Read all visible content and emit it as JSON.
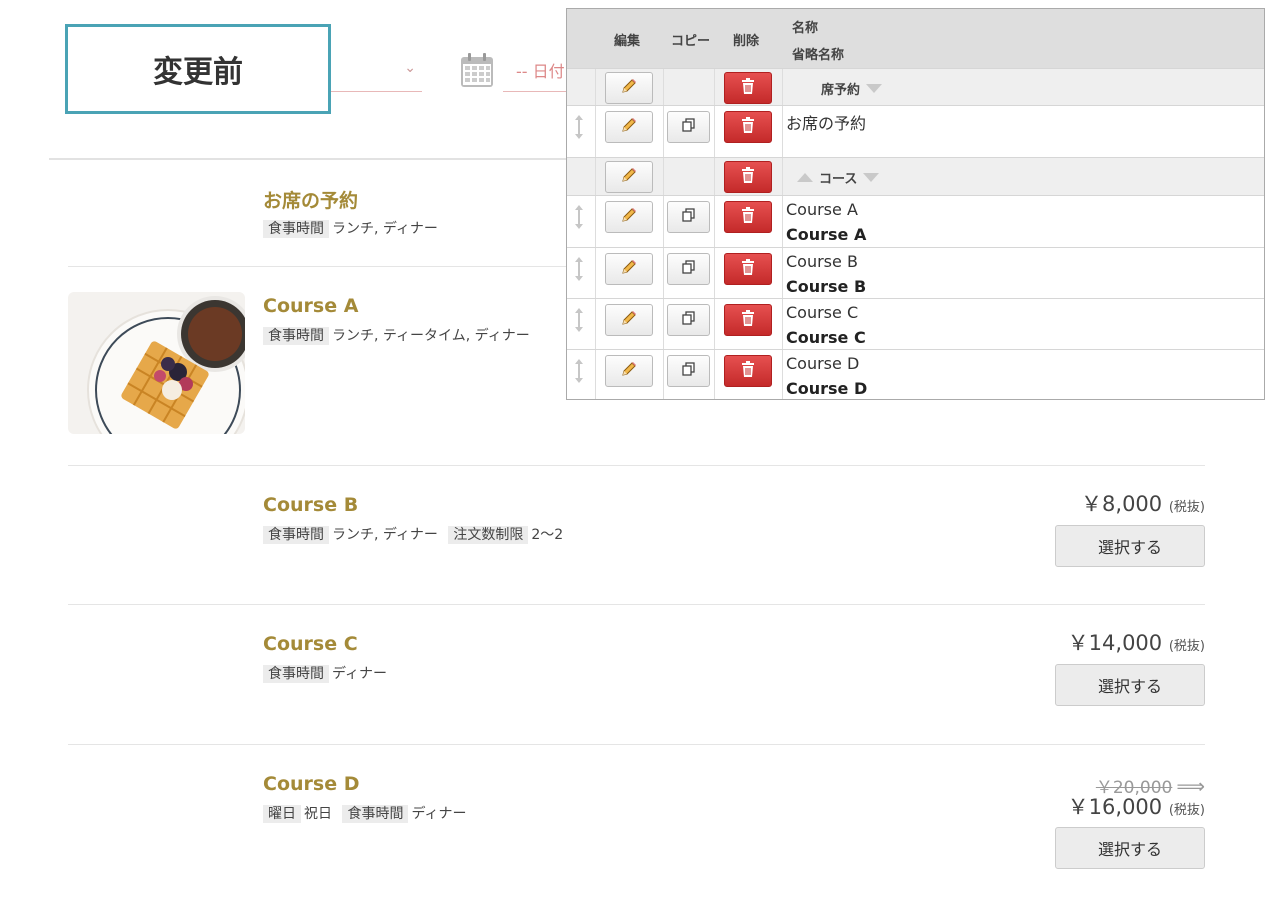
{
  "label_box": "変更前",
  "date_placeholder": "-- 日付",
  "admin": {
    "headers": {
      "edit": "編集",
      "copy": "コピー",
      "delete": "削除",
      "name": "名称",
      "short_name": "省略名称"
    },
    "rows": [
      {
        "type": "group",
        "label": "席予約"
      },
      {
        "type": "item",
        "name": "お席の予約",
        "short": ""
      },
      {
        "type": "group",
        "label": "コース"
      },
      {
        "type": "item",
        "name": "Course A",
        "short": "Course A"
      },
      {
        "type": "item",
        "name": "Course B",
        "short": "Course B"
      },
      {
        "type": "item",
        "name": "Course C",
        "short": "Course C"
      },
      {
        "type": "item",
        "name": "Course D",
        "short": "Course D"
      }
    ]
  },
  "items": [
    {
      "title": "お席の予約",
      "tags": [
        {
          "label": "食事時間",
          "value": "ランチ, ディナー"
        }
      ]
    },
    {
      "title": "Course A",
      "tags": [
        {
          "label": "食事時間",
          "value": "ランチ, ティータイム, ディナー"
        }
      ]
    },
    {
      "title": "Course B",
      "tags": [
        {
          "label": "食事時間",
          "value": "ランチ, ディナー"
        },
        {
          "label": "注文数制限",
          "value": "2～2"
        }
      ],
      "price": "￥8,000",
      "tax": "(税抜)",
      "button": "選択する"
    },
    {
      "title": "Course C",
      "tags": [
        {
          "label": "食事時間",
          "value": "ディナー"
        }
      ],
      "price": "￥14,000",
      "tax": "(税抜)",
      "button": "選択する"
    },
    {
      "title": "Course D",
      "tags": [
        {
          "label": "曜日",
          "value": "祝日"
        },
        {
          "label": "食事時間",
          "value": "ディナー"
        }
      ],
      "old_price": "￥20,000",
      "price": "￥16,000",
      "tax": "(税抜)",
      "button": "選択する"
    }
  ],
  "icons": {
    "edit": "pencil-icon",
    "copy": "copy-icon",
    "delete": "trash-icon",
    "drag": "drag-handle-icon",
    "calendar": "calendar-icon",
    "dropdown": "chevron-down-icon"
  },
  "colors": {
    "title": "#a48a38",
    "label_border": "#4aa3b5",
    "delete_button": "#d23a3a"
  }
}
